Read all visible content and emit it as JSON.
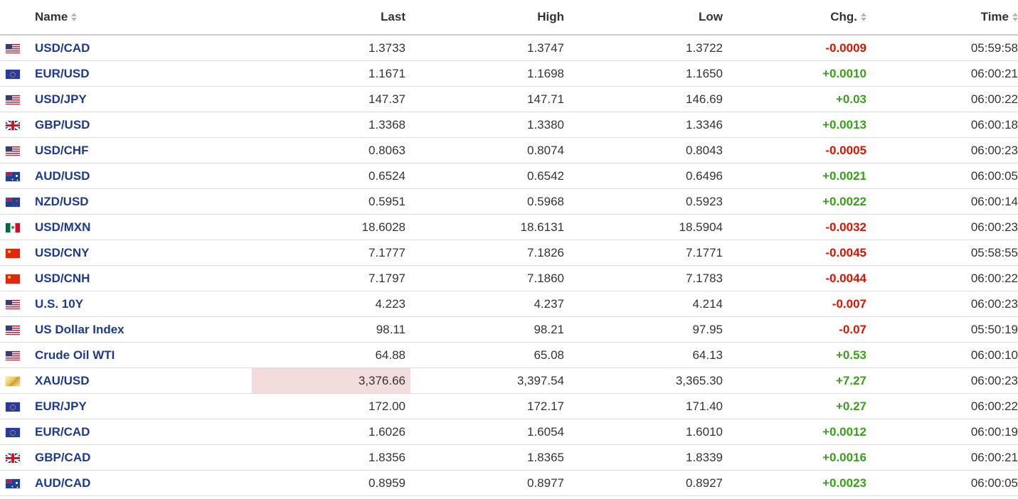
{
  "columns": {
    "name": "Name",
    "last": "Last",
    "high": "High",
    "low": "Low",
    "chg": "Chg.",
    "time": "Time"
  },
  "colors": {
    "positive": "#3a9f1a",
    "negative": "#d91400",
    "link": "#1d3a8f",
    "highlight": "#f3dcdc",
    "status_open": "#5ab82e",
    "status_closed": "#d9283b"
  },
  "rows": [
    {
      "flag": "us-flag-icon",
      "name": "USD/CAD",
      "last": "1.3733",
      "high": "1.3747",
      "low": "1.3722",
      "chg": "-0.0009",
      "direction": "down",
      "time": "05:59:58",
      "status": "open"
    },
    {
      "flag": "eu-flag-icon",
      "name": "EUR/USD",
      "last": "1.1671",
      "high": "1.1698",
      "low": "1.1650",
      "chg": "+0.0010",
      "direction": "up",
      "time": "06:00:21",
      "status": "open"
    },
    {
      "flag": "us-flag-icon",
      "name": "USD/JPY",
      "last": "147.37",
      "high": "147.71",
      "low": "146.69",
      "chg": "+0.03",
      "direction": "up",
      "time": "06:00:22",
      "status": "open"
    },
    {
      "flag": "gb-flag-icon",
      "name": "GBP/USD",
      "last": "1.3368",
      "high": "1.3380",
      "low": "1.3346",
      "chg": "+0.0013",
      "direction": "up",
      "time": "06:00:18",
      "status": "open"
    },
    {
      "flag": "us-flag-icon",
      "name": "USD/CHF",
      "last": "0.8063",
      "high": "0.8074",
      "low": "0.8043",
      "chg": "-0.0005",
      "direction": "down",
      "time": "06:00:23",
      "status": "open"
    },
    {
      "flag": "au-flag-icon",
      "name": "AUD/USD",
      "last": "0.6524",
      "high": "0.6542",
      "low": "0.6496",
      "chg": "+0.0021",
      "direction": "up",
      "time": "06:00:05",
      "status": "open"
    },
    {
      "flag": "nz-flag-icon",
      "name": "NZD/USD",
      "last": "0.5951",
      "high": "0.5968",
      "low": "0.5923",
      "chg": "+0.0022",
      "direction": "up",
      "time": "06:00:14",
      "status": "open"
    },
    {
      "flag": "us-flag-icon",
      "name": "USD/MXN",
      "last": "18.6028",
      "high": "18.6131",
      "low": "18.5904",
      "chg": "-0.0032",
      "direction": "down",
      "time": "06:00:23",
      "status": "open"
    },
    {
      "flag": "cn-flag-icon",
      "name": "USD/CNY",
      "last": "7.1777",
      "high": "7.1826",
      "low": "7.1771",
      "chg": "-0.0045",
      "direction": "down",
      "time": "05:58:55",
      "status": "open"
    },
    {
      "flag": "cn-flag-icon",
      "name": "USD/CNH",
      "last": "7.1797",
      "high": "7.1860",
      "low": "7.1783",
      "chg": "-0.0044",
      "direction": "down",
      "time": "06:00:22",
      "status": "open"
    },
    {
      "flag": "us-flag-icon",
      "name": "U.S. 10Y",
      "last": "4.223",
      "high": "4.237",
      "low": "4.214",
      "chg": "-0.007",
      "direction": "down",
      "time": "06:00:23",
      "status": "closed"
    },
    {
      "flag": "us-flag-icon",
      "name": "US Dollar Index",
      "last": "98.11",
      "high": "98.21",
      "low": "97.95",
      "chg": "-0.07",
      "direction": "down",
      "time": "05:50:19",
      "status": "open"
    },
    {
      "flag": "us-flag-icon",
      "name": "Crude Oil WTI",
      "last": "64.88",
      "high": "65.08",
      "low": "64.13",
      "chg": "+0.53",
      "direction": "up",
      "time": "06:00:10",
      "status": "open"
    },
    {
      "flag": "gold-bar-icon",
      "name": "XAU/USD",
      "last": "3,376.66",
      "high": "3,397.54",
      "low": "3,365.30",
      "chg": "+7.27",
      "direction": "up",
      "time": "06:00:23",
      "status": "open",
      "last_highlight": true
    },
    {
      "flag": "eu-flag-icon",
      "name": "EUR/JPY",
      "last": "172.00",
      "high": "172.17",
      "low": "171.40",
      "chg": "+0.27",
      "direction": "up",
      "time": "06:00:22",
      "status": "open"
    },
    {
      "flag": "eu-flag-icon",
      "name": "EUR/CAD",
      "last": "1.6026",
      "high": "1.6054",
      "low": "1.6010",
      "chg": "+0.0012",
      "direction": "up",
      "time": "06:00:19",
      "status": "open"
    },
    {
      "flag": "gb-flag-icon",
      "name": "GBP/CAD",
      "last": "1.8356",
      "high": "1.8365",
      "low": "1.8339",
      "chg": "+0.0016",
      "direction": "up",
      "time": "06:00:21",
      "status": "open"
    },
    {
      "flag": "au-flag-icon",
      "name": "AUD/CAD",
      "last": "0.8959",
      "high": "0.8977",
      "low": "0.8927",
      "chg": "+0.0023",
      "direction": "up",
      "time": "06:00:05",
      "status": "open"
    }
  ]
}
